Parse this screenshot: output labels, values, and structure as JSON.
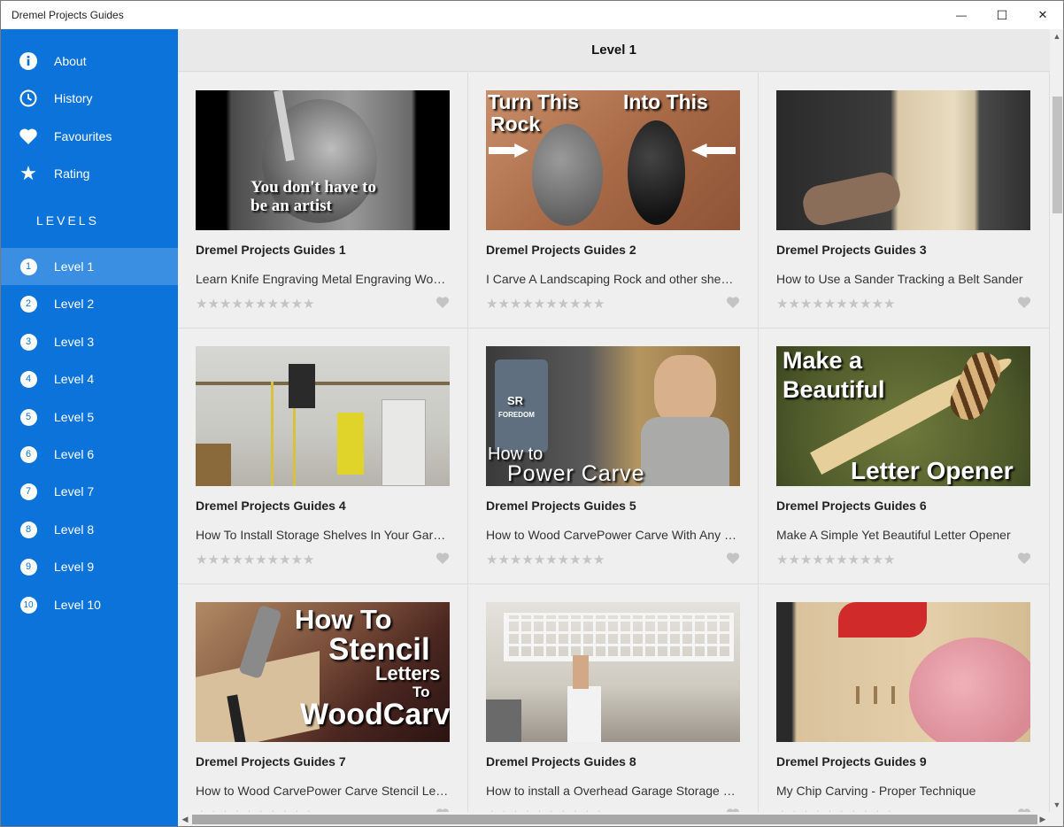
{
  "window": {
    "title": "Dremel Projects Guides",
    "controls": {
      "minimize": "—",
      "maximize": "☐",
      "close": "✕"
    }
  },
  "sidebar": {
    "menu": [
      {
        "label": "About",
        "icon": "info-icon"
      },
      {
        "label": "History",
        "icon": "clock-icon"
      },
      {
        "label": "Favourites",
        "icon": "heart-icon"
      },
      {
        "label": "Rating",
        "icon": "star-icon"
      }
    ],
    "levels_header": "LEVELS",
    "levels": [
      {
        "num": "1",
        "label": "Level 1",
        "active": true
      },
      {
        "num": "2",
        "label": "Level 2"
      },
      {
        "num": "3",
        "label": "Level 3"
      },
      {
        "num": "4",
        "label": "Level 4"
      },
      {
        "num": "5",
        "label": "Level 5"
      },
      {
        "num": "6",
        "label": "Level 6"
      },
      {
        "num": "7",
        "label": "Level 7"
      },
      {
        "num": "8",
        "label": "Level 8"
      },
      {
        "num": "9",
        "label": "Level 9"
      },
      {
        "num": "10",
        "label": "Level 10"
      }
    ]
  },
  "main": {
    "title": "Level 1",
    "stars": "★★★★★★★★★★",
    "cards": [
      {
        "title": "Dremel Projects Guides 1",
        "desc": "Learn Knife Engraving Metal Engraving Wo…",
        "thumb_text": [
          "You don't have to",
          "be an artist"
        ]
      },
      {
        "title": "Dremel Projects Guides 2",
        "desc": "I Carve A Landscaping Rock and other shen…",
        "thumb_text": [
          "Turn This",
          "Rock",
          "Into This"
        ]
      },
      {
        "title": "Dremel Projects Guides 3",
        "desc": "How to Use a Sander Tracking a Belt Sander",
        "thumb_text": []
      },
      {
        "title": "Dremel Projects Guides 4",
        "desc": "How To Install Storage Shelves In Your Gar…",
        "thumb_text": []
      },
      {
        "title": "Dremel Projects Guides 5",
        "desc": "How to Wood CarvePower Carve With Any …",
        "thumb_text": [
          "How to",
          "Power Carve",
          "SR",
          "FOREDOM"
        ]
      },
      {
        "title": "Dremel Projects Guides 6",
        "desc": "Make A Simple Yet Beautiful Letter Opener",
        "thumb_text": [
          "Make a",
          "Beautiful",
          "Letter Opener"
        ]
      },
      {
        "title": "Dremel Projects Guides 7",
        "desc": "How to Wood CarvePower Carve Stencil Le…",
        "thumb_text": [
          "How To",
          "Stencil",
          "Letters",
          "To",
          "WoodCarve"
        ]
      },
      {
        "title": "Dremel Projects Guides 8",
        "desc": "How to install a Overhead Garage Storage …",
        "thumb_text": []
      },
      {
        "title": "Dremel Projects Guides 9",
        "desc": "My Chip Carving - Proper Technique",
        "thumb_text": []
      }
    ]
  },
  "colors": {
    "sidebar": "#0b73d9",
    "sidebar_active": "#3a8fe3",
    "content_bg": "#efefef"
  }
}
